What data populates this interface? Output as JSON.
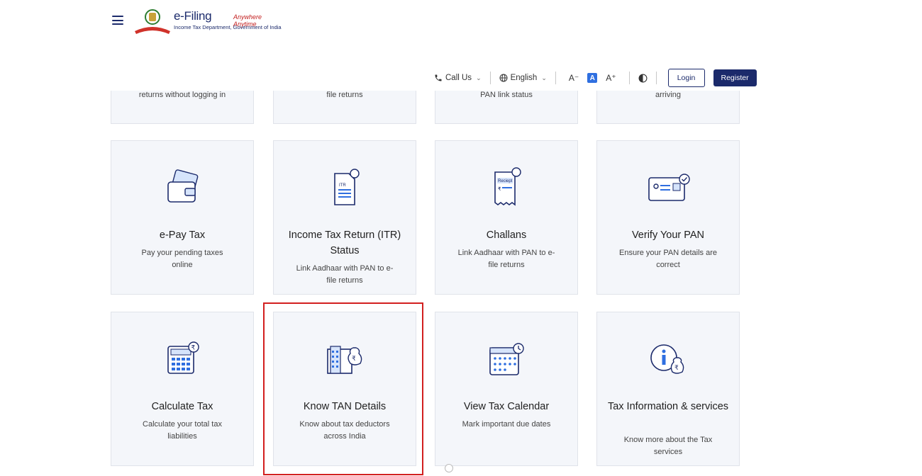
{
  "header": {
    "brand": "e-Filing",
    "tagline": "Anywhere Anytime",
    "subtitle": "Income Tax Department, Government of India"
  },
  "topbar": {
    "call_label": "Call Us",
    "language_label": "English",
    "font_decrease": "A⁻",
    "font_default": "A",
    "font_increase": "A⁺",
    "login_label": "Login",
    "register_label": "Register"
  },
  "partial_row": [
    {
      "desc": "returns without logging in"
    },
    {
      "desc": "file returns"
    },
    {
      "desc": "PAN link status"
    },
    {
      "desc": "arriving"
    }
  ],
  "cards_row1": [
    {
      "title": "e-Pay Tax",
      "desc": "Pay your pending taxes online",
      "icon": "wallet-card-icon"
    },
    {
      "title": "Income Tax Return (ITR) Status",
      "desc": "Link Aadhaar with PAN to e-file returns",
      "icon": "itr-document-icon"
    },
    {
      "title": "Challans",
      "desc": "Link Aadhaar with PAN to e-file returns",
      "icon": "receipt-icon"
    },
    {
      "title": "Verify Your PAN",
      "desc": "Ensure your PAN details are correct",
      "icon": "pan-card-icon"
    }
  ],
  "cards_row2": [
    {
      "title": "Calculate Tax",
      "desc": "Calculate your total tax liabilities",
      "icon": "calculator-icon"
    },
    {
      "title": "Know TAN Details",
      "desc": "Know about tax deductors across India",
      "icon": "tan-building-icon"
    },
    {
      "title": "View Tax Calendar",
      "desc": "Mark important due dates",
      "icon": "calendar-icon"
    },
    {
      "title": "Tax Information & services",
      "desc": "Know more about the Tax services",
      "icon": "info-money-icon"
    }
  ],
  "colors": {
    "primary": "#1b2a6b",
    "accent": "#2f6fe0",
    "highlight": "#d21f1f",
    "card_bg": "#f4f6fa"
  }
}
